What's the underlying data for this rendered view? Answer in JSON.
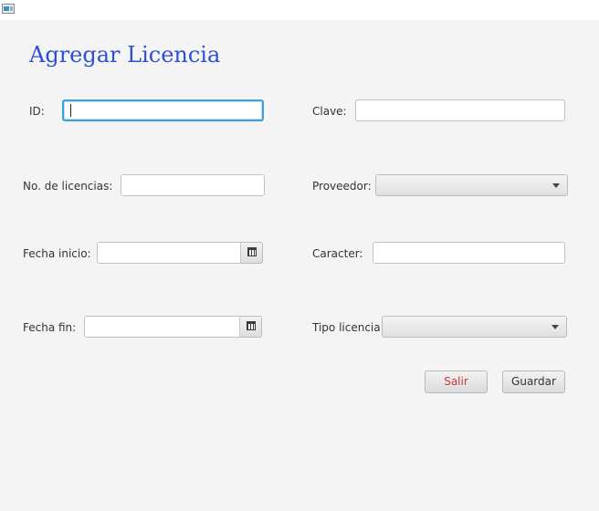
{
  "window": {
    "icon": "window-app-icon"
  },
  "form": {
    "title": "Agregar Licencia",
    "labels": {
      "id": "ID:",
      "clave": "Clave:",
      "num_licencias": "No. de licencias:",
      "proveedor": "Proveedor:",
      "fecha_inicio": "Fecha inicio:",
      "caracter": "Caracter:",
      "fecha_fin": "Fecha fin:",
      "tipo_licencia": "Tipo licencia:"
    },
    "values": {
      "id": "",
      "clave": "",
      "num_licencias": "",
      "proveedor": "",
      "fecha_inicio": "",
      "caracter": "",
      "fecha_fin": "",
      "tipo_licencia": ""
    },
    "icons": {
      "date_picker": "calendar-icon",
      "combo_arrow": "chevron-down-icon"
    }
  },
  "actions": {
    "salir": "Salir",
    "guardar": "Guardar"
  },
  "colors": {
    "title": "#2e4ed4",
    "focus_border": "#3aa0e0",
    "salir_text": "#c23a3a",
    "background": "#f4f4f4"
  }
}
